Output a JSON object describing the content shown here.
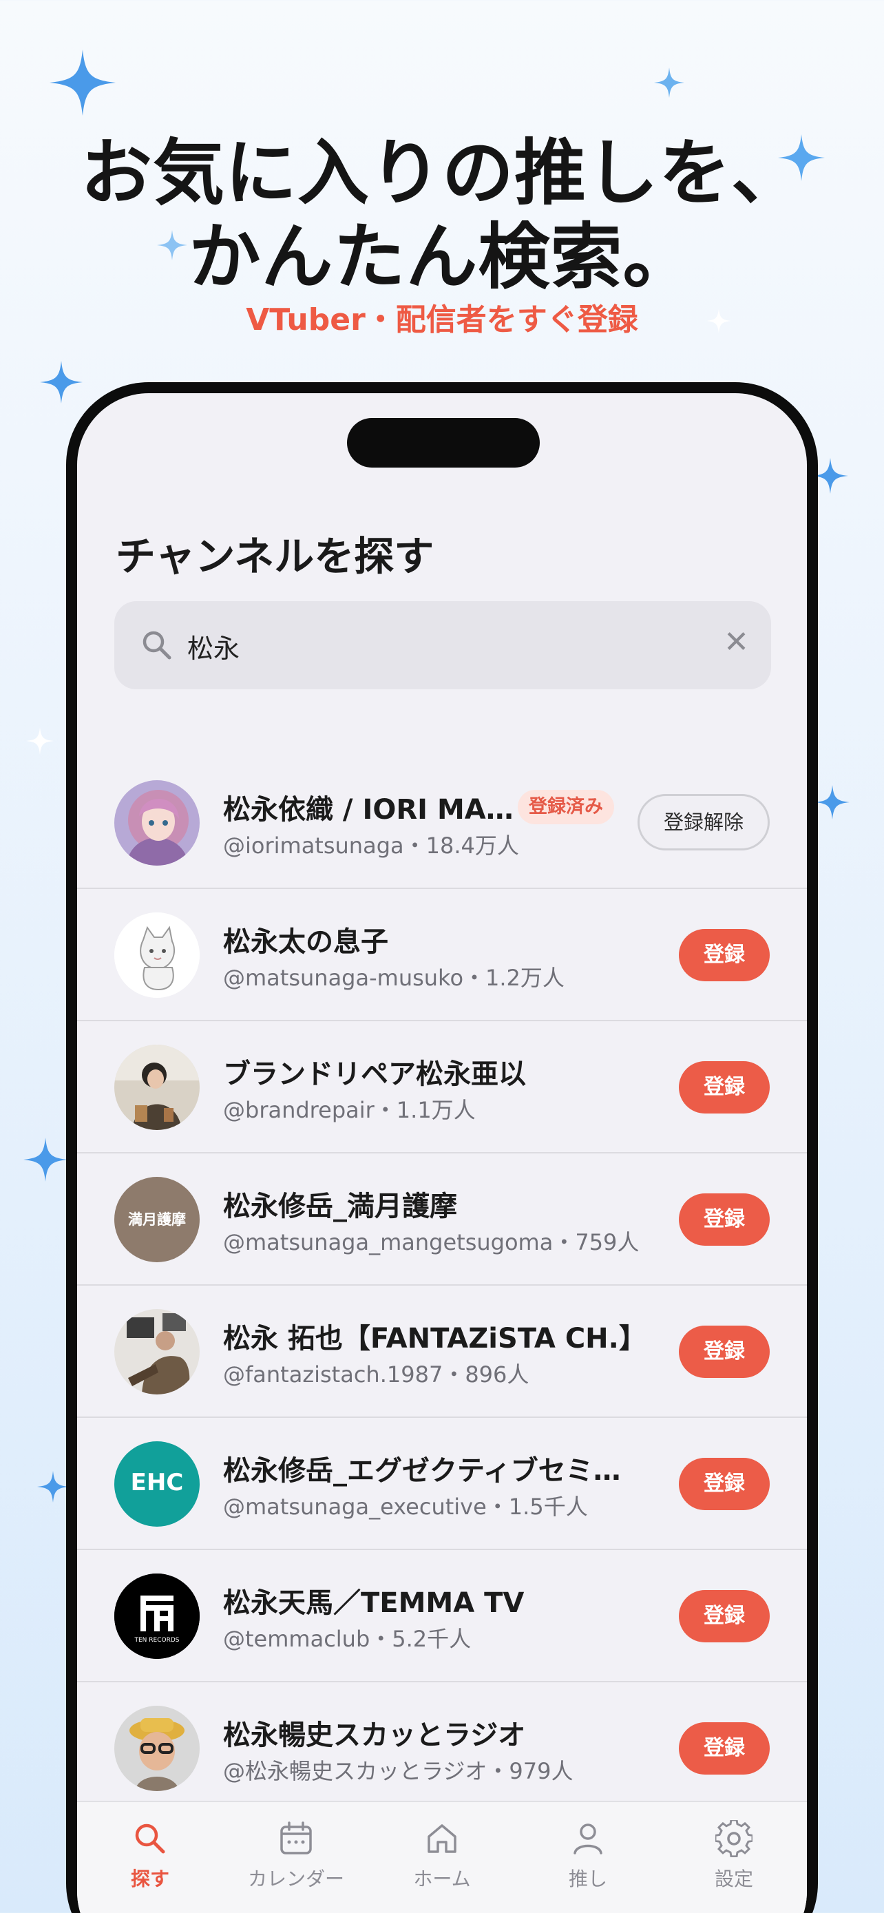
{
  "hero": {
    "title_line1": "お気に入りの推しを、",
    "title_line2": "かんたん検索。",
    "subtitle": "VTuber・配信者をすぐ登録"
  },
  "screen": {
    "title": "チャンネルを探す",
    "search": {
      "value": "松永",
      "clear_symbol": "✕"
    }
  },
  "results": [
    {
      "name": "松永依織 / IORI MA…",
      "meta": "@iorimatsunaga・18.4万人",
      "subscribed": true,
      "badge": "登録済み",
      "action": "登録解除"
    },
    {
      "name": "松永太の息子",
      "meta": "@matsunaga-musuko・1.2万人",
      "subscribed": false,
      "action": "登録"
    },
    {
      "name": "ブランドリペア松永亜以",
      "meta": "@brandrepair・1.1万人",
      "subscribed": false,
      "action": "登録"
    },
    {
      "name": "松永修岳_満月護摩",
      "meta": "@matsunaga_mangetsugoma・759人",
      "subscribed": false,
      "action": "登録",
      "avatar_text": "満月護摩"
    },
    {
      "name": " 松永 拓也【FANTAZiSTA CH.】",
      "meta": "@fantazistach.1987・896人",
      "subscribed": false,
      "action": "登録"
    },
    {
      "name": "松永修岳_エグゼクティブセミ…",
      "meta": "@matsunaga_executive・1.5千人",
      "subscribed": false,
      "action": "登録",
      "avatar_text": "EHC"
    },
    {
      "name": "松永天馬／TEMMA TV",
      "meta": "@temmaclub・5.2千人",
      "subscribed": false,
      "action": "登録",
      "avatar_text": "TEN RECORDS"
    },
    {
      "name": "松永暢史スカッとラジオ",
      "meta": "@松永暢史スカッとラジオ・979人",
      "subscribed": false,
      "action": "登録"
    }
  ],
  "tabs": [
    {
      "label": "探す",
      "icon": "search-icon",
      "active": true
    },
    {
      "label": "カレンダー",
      "icon": "calendar-icon",
      "active": false
    },
    {
      "label": "ホーム",
      "icon": "home-icon",
      "active": false
    },
    {
      "label": "推し",
      "icon": "person-icon",
      "active": false
    },
    {
      "label": "設定",
      "icon": "gear-icon",
      "active": false
    }
  ],
  "colors": {
    "accent": "#ec5c48",
    "sparkle": "#4a9ae9",
    "badge_bg": "#fde4df"
  }
}
